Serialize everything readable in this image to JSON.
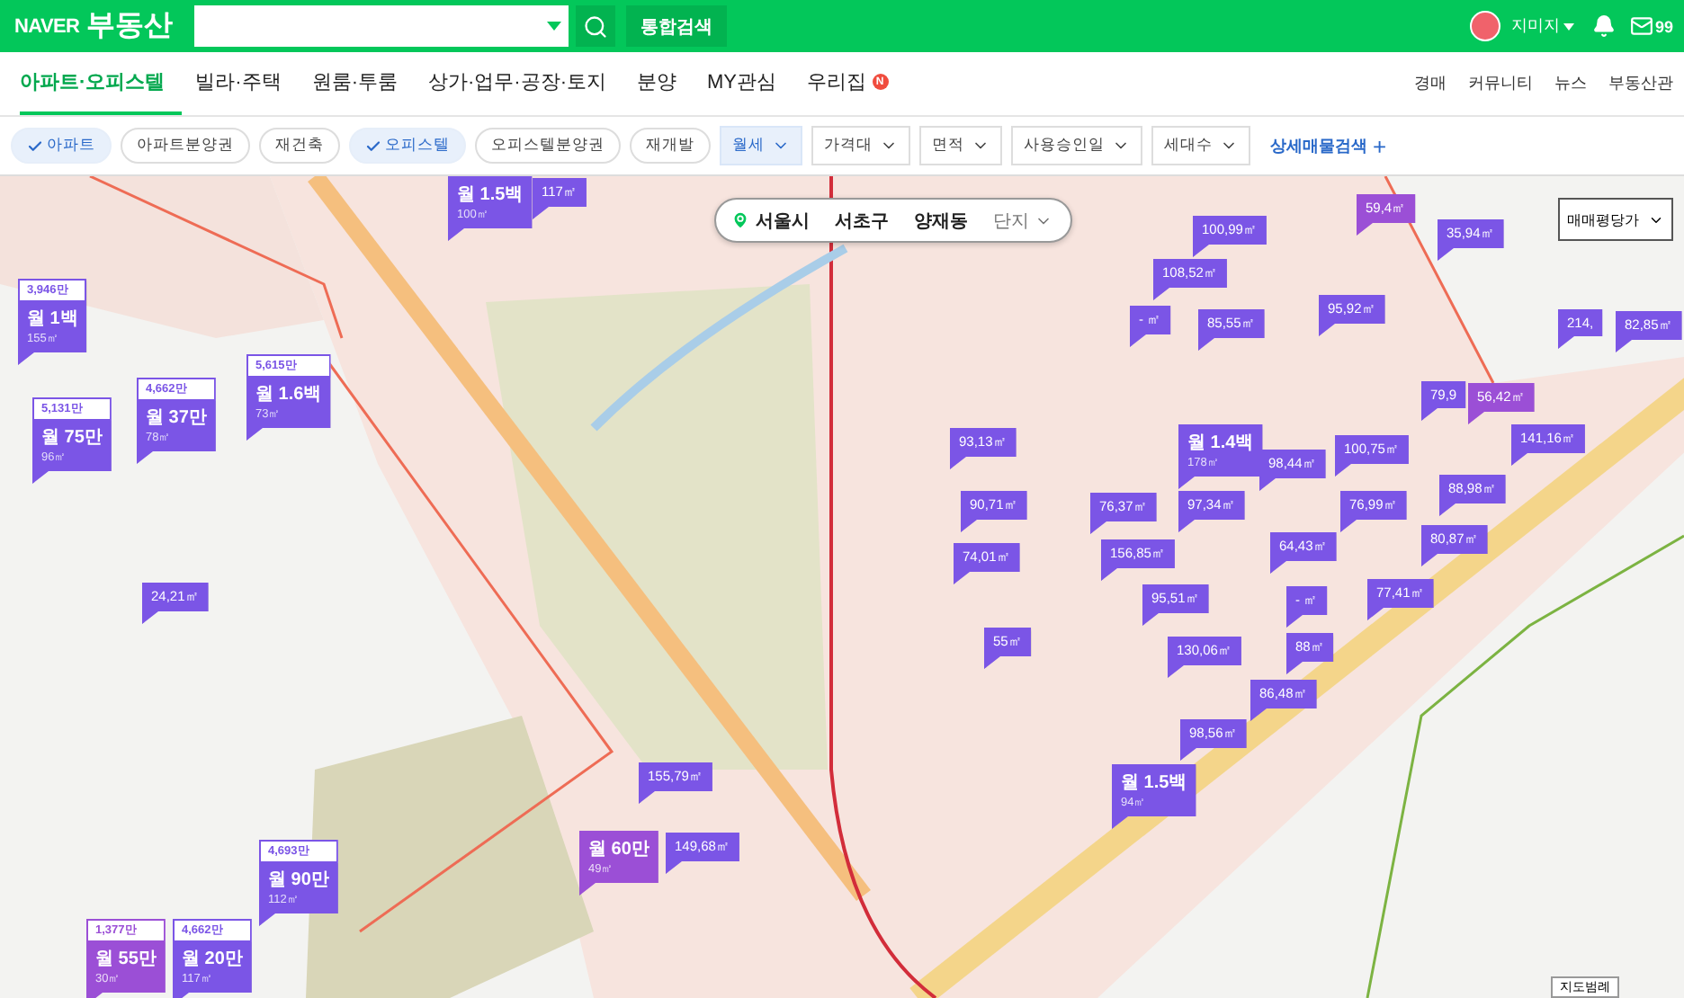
{
  "header": {
    "logo_brand": "NAVER",
    "logo_title": "부동산",
    "search_button_label": "통합검색",
    "user": "지미지",
    "mail_count": "99"
  },
  "nav": {
    "tabs": [
      {
        "label": "아파트·오피스텔",
        "selected": true
      },
      {
        "label": "빌라·주택",
        "selected": false
      },
      {
        "label": "원룸·투룸",
        "selected": false
      },
      {
        "label": "상가·업무·공장·토지",
        "selected": false
      },
      {
        "label": "분양",
        "selected": false
      },
      {
        "label": "MY관심",
        "selected": false
      },
      {
        "label": "우리집",
        "selected": false,
        "badge": "N"
      }
    ],
    "links": [
      "경매",
      "커뮤니티",
      "뉴스",
      "부동산관"
    ]
  },
  "filters": {
    "chips": [
      {
        "label": "아파트",
        "checked": true
      },
      {
        "label": "아파트분양권",
        "checked": false
      },
      {
        "label": "재건축",
        "checked": false
      },
      {
        "label": "오피스텔",
        "checked": true
      },
      {
        "label": "오피스텔분양권",
        "checked": false
      },
      {
        "label": "재개발",
        "checked": false
      }
    ],
    "dropdowns": [
      {
        "label": "월세",
        "selected": true
      },
      {
        "label": "가격대",
        "selected": false
      },
      {
        "label": "면적",
        "selected": false
      },
      {
        "label": "사용승인일",
        "selected": false
      },
      {
        "label": "세대수",
        "selected": false
      }
    ],
    "detail_search": "상세매물검색",
    "detail_plus": "+"
  },
  "map": {
    "location": [
      "서울시",
      "서초구",
      "양재동"
    ],
    "location_level": "단지",
    "price_dropdown": "매매평당가",
    "legend": "지도범례",
    "markers": [
      {
        "kind": "rent",
        "price": "월 1.5백",
        "area": "100㎡",
        "color": "#7b55e6"
      },
      {
        "kind": "area",
        "area": "117㎡",
        "color": "#7b55e6"
      },
      {
        "kind": "area",
        "area": "100,99㎡",
        "color": "#7b55e6"
      },
      {
        "kind": "area",
        "area": "59,4㎡",
        "color": "#9b4fd6"
      },
      {
        "kind": "area",
        "area": "35,94㎡",
        "color": "#7b55e6"
      },
      {
        "kind": "rent",
        "deposit": "3,946만",
        "price": "월 1백",
        "area": "155㎡",
        "color": "#7b55e6"
      },
      {
        "kind": "area",
        "area": "108,52㎡",
        "color": "#7b55e6"
      },
      {
        "kind": "area",
        "area": "- ㎡",
        "color": "#7b55e6"
      },
      {
        "kind": "area",
        "area": "85,55㎡",
        "color": "#7b55e6"
      },
      {
        "kind": "area",
        "area": "95,92㎡",
        "color": "#7b55e6"
      },
      {
        "kind": "area",
        "area": "214,",
        "color": "#7b55e6"
      },
      {
        "kind": "area",
        "area": "82,85㎡",
        "color": "#7b55e6"
      },
      {
        "kind": "rent",
        "deposit": "5,131만",
        "price": "월 75만",
        "area": "96㎡",
        "color": "#7b55e6"
      },
      {
        "kind": "rent",
        "deposit": "4,662만",
        "price": "월 37만",
        "area": "78㎡",
        "color": "#7b55e6"
      },
      {
        "kind": "rent",
        "deposit": "5,615만",
        "price": "월 1.6백",
        "area": "73㎡",
        "color": "#7b55e6"
      },
      {
        "kind": "area",
        "area": "79,9",
        "color": "#7b55e6"
      },
      {
        "kind": "area",
        "area": "56,42㎡",
        "color": "#9b4fd6"
      },
      {
        "kind": "area",
        "area": "93,13㎡",
        "color": "#7b55e6"
      },
      {
        "kind": "rent",
        "price": "월 1.4백",
        "area": "178㎡",
        "color": "#7b55e6"
      },
      {
        "kind": "area",
        "area": "98,44㎡",
        "color": "#7b55e6"
      },
      {
        "kind": "area",
        "area": "100,75㎡",
        "color": "#7b55e6"
      },
      {
        "kind": "area",
        "area": "141,16㎡",
        "color": "#7b55e6"
      },
      {
        "kind": "area",
        "area": "90,71㎡",
        "color": "#7b55e6"
      },
      {
        "kind": "area",
        "area": "76,37㎡",
        "color": "#7b55e6"
      },
      {
        "kind": "area",
        "area": "97,34㎡",
        "color": "#7b55e6"
      },
      {
        "kind": "area",
        "area": "76,99㎡",
        "color": "#7b55e6"
      },
      {
        "kind": "area",
        "area": "88,98㎡",
        "color": "#7b55e6"
      },
      {
        "kind": "area",
        "area": "74,01㎡",
        "color": "#7b55e6"
      },
      {
        "kind": "area",
        "area": "156,85㎡",
        "color": "#7b55e6"
      },
      {
        "kind": "area",
        "area": "64,43㎡",
        "color": "#7b55e6"
      },
      {
        "kind": "area",
        "area": "80,87㎡",
        "color": "#7b55e6"
      },
      {
        "kind": "area",
        "area": "24,21㎡",
        "color": "#7b55e6"
      },
      {
        "kind": "area",
        "area": "95,51㎡",
        "color": "#7b55e6"
      },
      {
        "kind": "area",
        "area": "- ㎡",
        "color": "#7b55e6"
      },
      {
        "kind": "area",
        "area": "77,41㎡",
        "color": "#7b55e6"
      },
      {
        "kind": "area",
        "area": "55㎡",
        "color": "#7b55e6"
      },
      {
        "kind": "area",
        "area": "130,06㎡",
        "color": "#7b55e6"
      },
      {
        "kind": "area",
        "area": "88㎡",
        "color": "#7b55e6"
      },
      {
        "kind": "area",
        "area": "86,48㎡",
        "color": "#7b55e6"
      },
      {
        "kind": "area",
        "area": "98,56㎡",
        "color": "#7b55e6"
      },
      {
        "kind": "area",
        "area": "155,79㎡",
        "color": "#7b55e6"
      },
      {
        "kind": "rent",
        "price": "월 1.5백",
        "area": "94㎡",
        "color": "#7b55e6"
      },
      {
        "kind": "rent",
        "deposit": "4,693만",
        "price": "월 90만",
        "area": "112㎡",
        "color": "#7b55e6"
      },
      {
        "kind": "rent",
        "price": "월 60만",
        "area": "49㎡",
        "color": "#9b4fd6"
      },
      {
        "kind": "area",
        "area": "149,68㎡",
        "color": "#7b55e6"
      },
      {
        "kind": "rent",
        "deposit": "1,377만",
        "price": "월 55만",
        "area": "30㎡",
        "color": "#9b4fd6"
      },
      {
        "kind": "rent",
        "deposit": "4,662만",
        "price": "월 20만",
        "area": "117㎡",
        "color": "#7b55e6"
      }
    ]
  }
}
